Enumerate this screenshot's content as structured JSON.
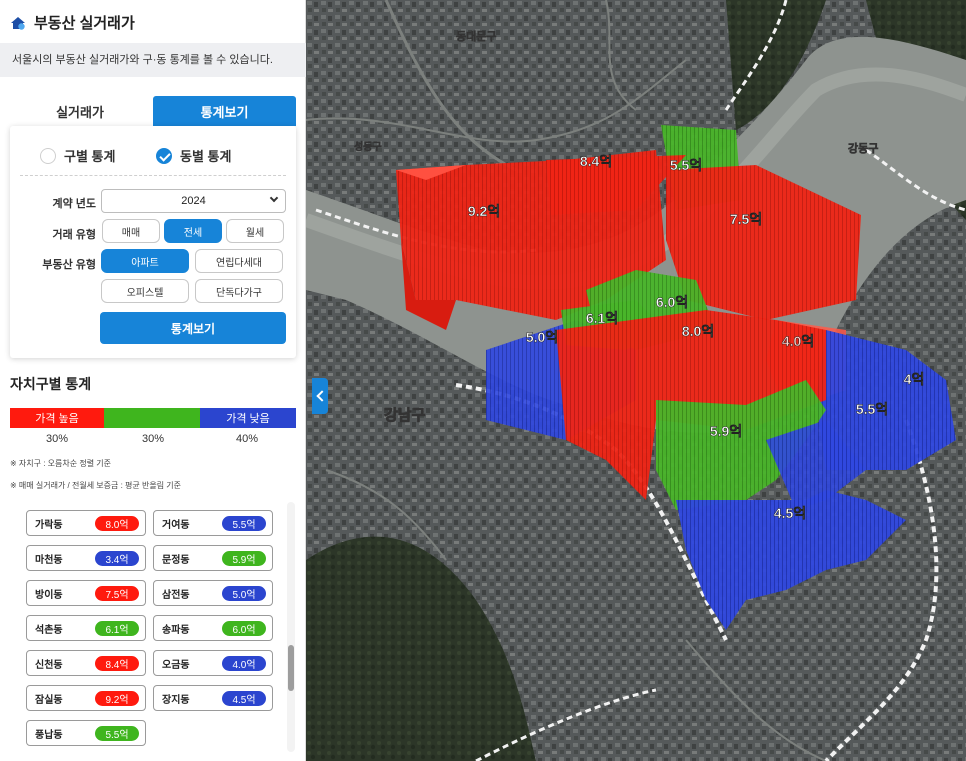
{
  "header": {
    "title": "부동산 실거래가",
    "subtitle": "서울시의 부동산 실거래가와 구·동 통계를 볼 수 있습니다."
  },
  "tabs": [
    {
      "label": "실거래가",
      "active": false
    },
    {
      "label": "통계보기",
      "active": true
    }
  ],
  "filter": {
    "radio_gu": "구별 통계",
    "radio_dong": "동별 통계",
    "year_label": "계약 년도",
    "year_value": "2024",
    "trade_label": "거래 유형",
    "trade_types": [
      "매매",
      "전세",
      "월세"
    ],
    "trade_selected": "전세",
    "estate_label": "부동산 유형",
    "estate_types": [
      "아파트",
      "연립다세대",
      "오피스텔",
      "단독다가구"
    ],
    "estate_selected": "아파트",
    "submit_label": "통계보기"
  },
  "stats": {
    "title": "자치구별 통계",
    "legend_high": "가격 높음",
    "legend_low": "가격 낮음",
    "pct_high": "30%",
    "pct_mid": "30%",
    "pct_low": "40%",
    "note1": "※ 자치구 : 오름차순 정렬 기준",
    "note2": "※ 매매 실거래가 / 전월세 보증금 : 평균 반올림 기준",
    "colors": {
      "high": "#ff1a0e",
      "mid": "#3fb51e",
      "low": "#2b45cf"
    },
    "items": [
      {
        "name": "가락동",
        "value": "8.0억",
        "level": "high"
      },
      {
        "name": "거여동",
        "value": "5.5억",
        "level": "low"
      },
      {
        "name": "마천동",
        "value": "3.4억",
        "level": "low"
      },
      {
        "name": "문정동",
        "value": "5.9억",
        "level": "mid"
      },
      {
        "name": "방이동",
        "value": "7.5억",
        "level": "high"
      },
      {
        "name": "삼전동",
        "value": "5.0억",
        "level": "low"
      },
      {
        "name": "석촌동",
        "value": "6.1억",
        "level": "mid"
      },
      {
        "name": "송파동",
        "value": "6.0억",
        "level": "mid"
      },
      {
        "name": "신천동",
        "value": "8.4억",
        "level": "high"
      },
      {
        "name": "오금동",
        "value": "4.0억",
        "level": "low"
      },
      {
        "name": "잠실동",
        "value": "9.2억",
        "level": "high"
      },
      {
        "name": "장지동",
        "value": "4.5억",
        "level": "low"
      },
      {
        "name": "풍납동",
        "value": "5.5억",
        "level": "mid"
      }
    ]
  },
  "map": {
    "district_labels": [
      "동대문구",
      "성동구",
      "강동구",
      "강남구"
    ],
    "bar_labels": [
      "8.4억",
      "5.5억",
      "9.2억",
      "7.5억",
      "6.0억",
      "6.1억",
      "8.0억",
      "5.0억",
      "4.0억",
      "4억",
      "5.5억",
      "5.9억",
      "4.5억"
    ]
  }
}
